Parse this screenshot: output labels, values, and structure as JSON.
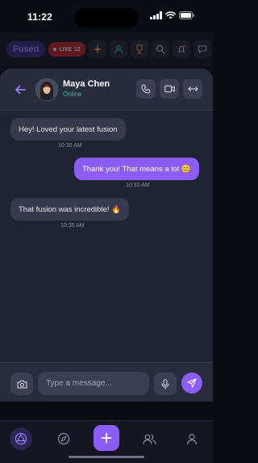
{
  "status_bar": {
    "time": "11:22"
  },
  "background_app": {
    "logo_label": "Fused",
    "live_label": "LIVE",
    "live_count": "12"
  },
  "chat": {
    "contact": {
      "name": "Maya Chen",
      "status": "Online"
    },
    "messages": [
      {
        "direction": "incoming",
        "text": "Hey! Loved your latest fusion",
        "time": "10:30 AM"
      },
      {
        "direction": "outgoing",
        "text": "Thank you! That means a lot 😊",
        "time": "10:32 AM"
      },
      {
        "direction": "incoming",
        "text": "That fusion was incredible! 🔥",
        "time": "10:35 AM"
      }
    ],
    "composer": {
      "placeholder": "Type a message..."
    }
  },
  "bottom_nav": {
    "items": [
      {
        "icon": "fusion-icon",
        "active": true
      },
      {
        "icon": "compass-icon",
        "active": false
      },
      {
        "icon": "plus-icon",
        "active": false
      },
      {
        "icon": "users-icon",
        "active": false
      },
      {
        "icon": "profile-icon",
        "active": false
      }
    ]
  },
  "colors": {
    "accent": "#8b5cf6",
    "online": "#27c27f",
    "sheet_background": "#1f2432"
  }
}
